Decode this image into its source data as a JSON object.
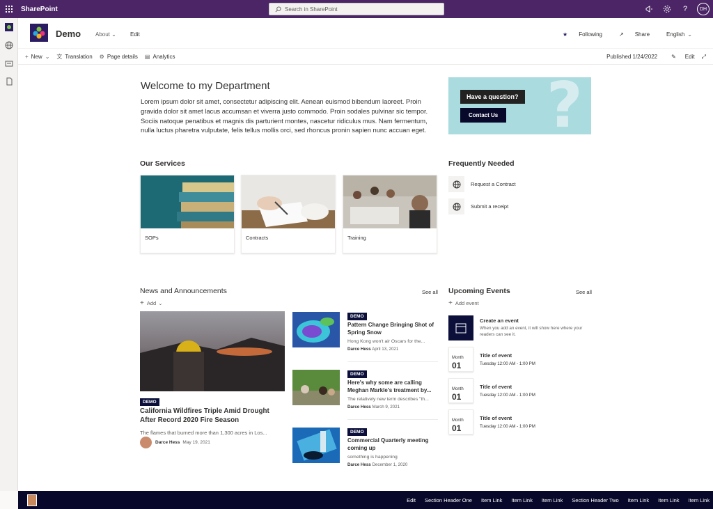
{
  "suite": {
    "app_name": "SharePoint",
    "search_placeholder": "Search in SharePoint",
    "user_initials": "DH"
  },
  "site": {
    "title": "Demo",
    "nav_about": "About",
    "nav_edit": "Edit",
    "following": "Following",
    "share": "Share",
    "language": "English"
  },
  "command_bar": {
    "new": "New",
    "translation": "Translation",
    "page_details": "Page details",
    "analytics": "Analytics",
    "published": "Published 1/24/2022",
    "edit": "Edit"
  },
  "welcome": {
    "title": "Welcome to my Department",
    "body": "Lorem ipsum dolor sit amet, consectetur adipiscing elit. Aenean euismod bibendum laoreet. Proin gravida dolor sit amet lacus accumsan et viverra justo commodo. Proin sodales pulvinar sic tempor. Sociis natoque penatibus et magnis dis parturient montes, nascetur ridiculus mus. Nam fermentum, nulla luctus pharetra vulputate, felis tellus mollis orci, sed rhoncus pronin sapien nunc accuan eget."
  },
  "promo": {
    "question": "Have a question?",
    "button": "Contact Us"
  },
  "services": {
    "title": "Our Services",
    "items": [
      {
        "label": "SOPs"
      },
      {
        "label": "Contracts"
      },
      {
        "label": "Training"
      }
    ]
  },
  "frequently_needed": {
    "title": "Frequently Needed",
    "items": [
      {
        "label": "Request a Contract"
      },
      {
        "label": "Submit a receipt"
      }
    ]
  },
  "news": {
    "title": "News and Announcements",
    "see_all": "See all",
    "add": "Add",
    "hero": {
      "badge": "DEMO",
      "title": "California Wildfires Triple Amid Drought After Record 2020 Fire Season",
      "desc": "The flames that burned more than 1,300 acres in Los...",
      "author": "Darce Hess",
      "date": "May 19, 2021"
    },
    "items": [
      {
        "badge": "DEMO",
        "title": "Pattern Change Bringing Shot of Spring Snow",
        "desc": "Hong Kong won't air Oscars for the...",
        "author": "Darce Hess",
        "date": "April 13, 2021"
      },
      {
        "badge": "DEMO",
        "title": "Here's why some are calling Meghan Markle's treatment by...",
        "desc": "The relatively new term describes \"th...",
        "author": "Darce Hess",
        "date": "March 9, 2021"
      },
      {
        "badge": "DEMO",
        "title": "Commercial Quarterly meeting coming up",
        "desc": "something is happening",
        "author": "Darce Hess",
        "date": "December 1, 2020"
      }
    ]
  },
  "events": {
    "title": "Upcoming Events",
    "see_all": "See all",
    "add": "Add event",
    "create_title": "Create an event",
    "create_desc": "When you add an event, it will show here where your readers can see it.",
    "items": [
      {
        "month": "Month",
        "day": "01",
        "title": "Title of event",
        "time": "Tuesday 12:00 AM - 1:00 PM"
      },
      {
        "month": "Month",
        "day": "01",
        "title": "Title of event",
        "time": "Tuesday 12:00 AM - 1:00 PM"
      },
      {
        "month": "Month",
        "day": "01",
        "title": "Title of event",
        "time": "Tuesday 12:00 AM - 1:00 PM"
      }
    ]
  },
  "footer": {
    "links": [
      "Edit",
      "Section Header One",
      "Item Link",
      "Item Link",
      "Item Link",
      "Section Header Two",
      "Item Link",
      "Item Link",
      "Item Link"
    ]
  },
  "colors": {
    "suite_bar": "#4b2566",
    "footer": "#08082a",
    "badge": "#0b0f3a"
  }
}
